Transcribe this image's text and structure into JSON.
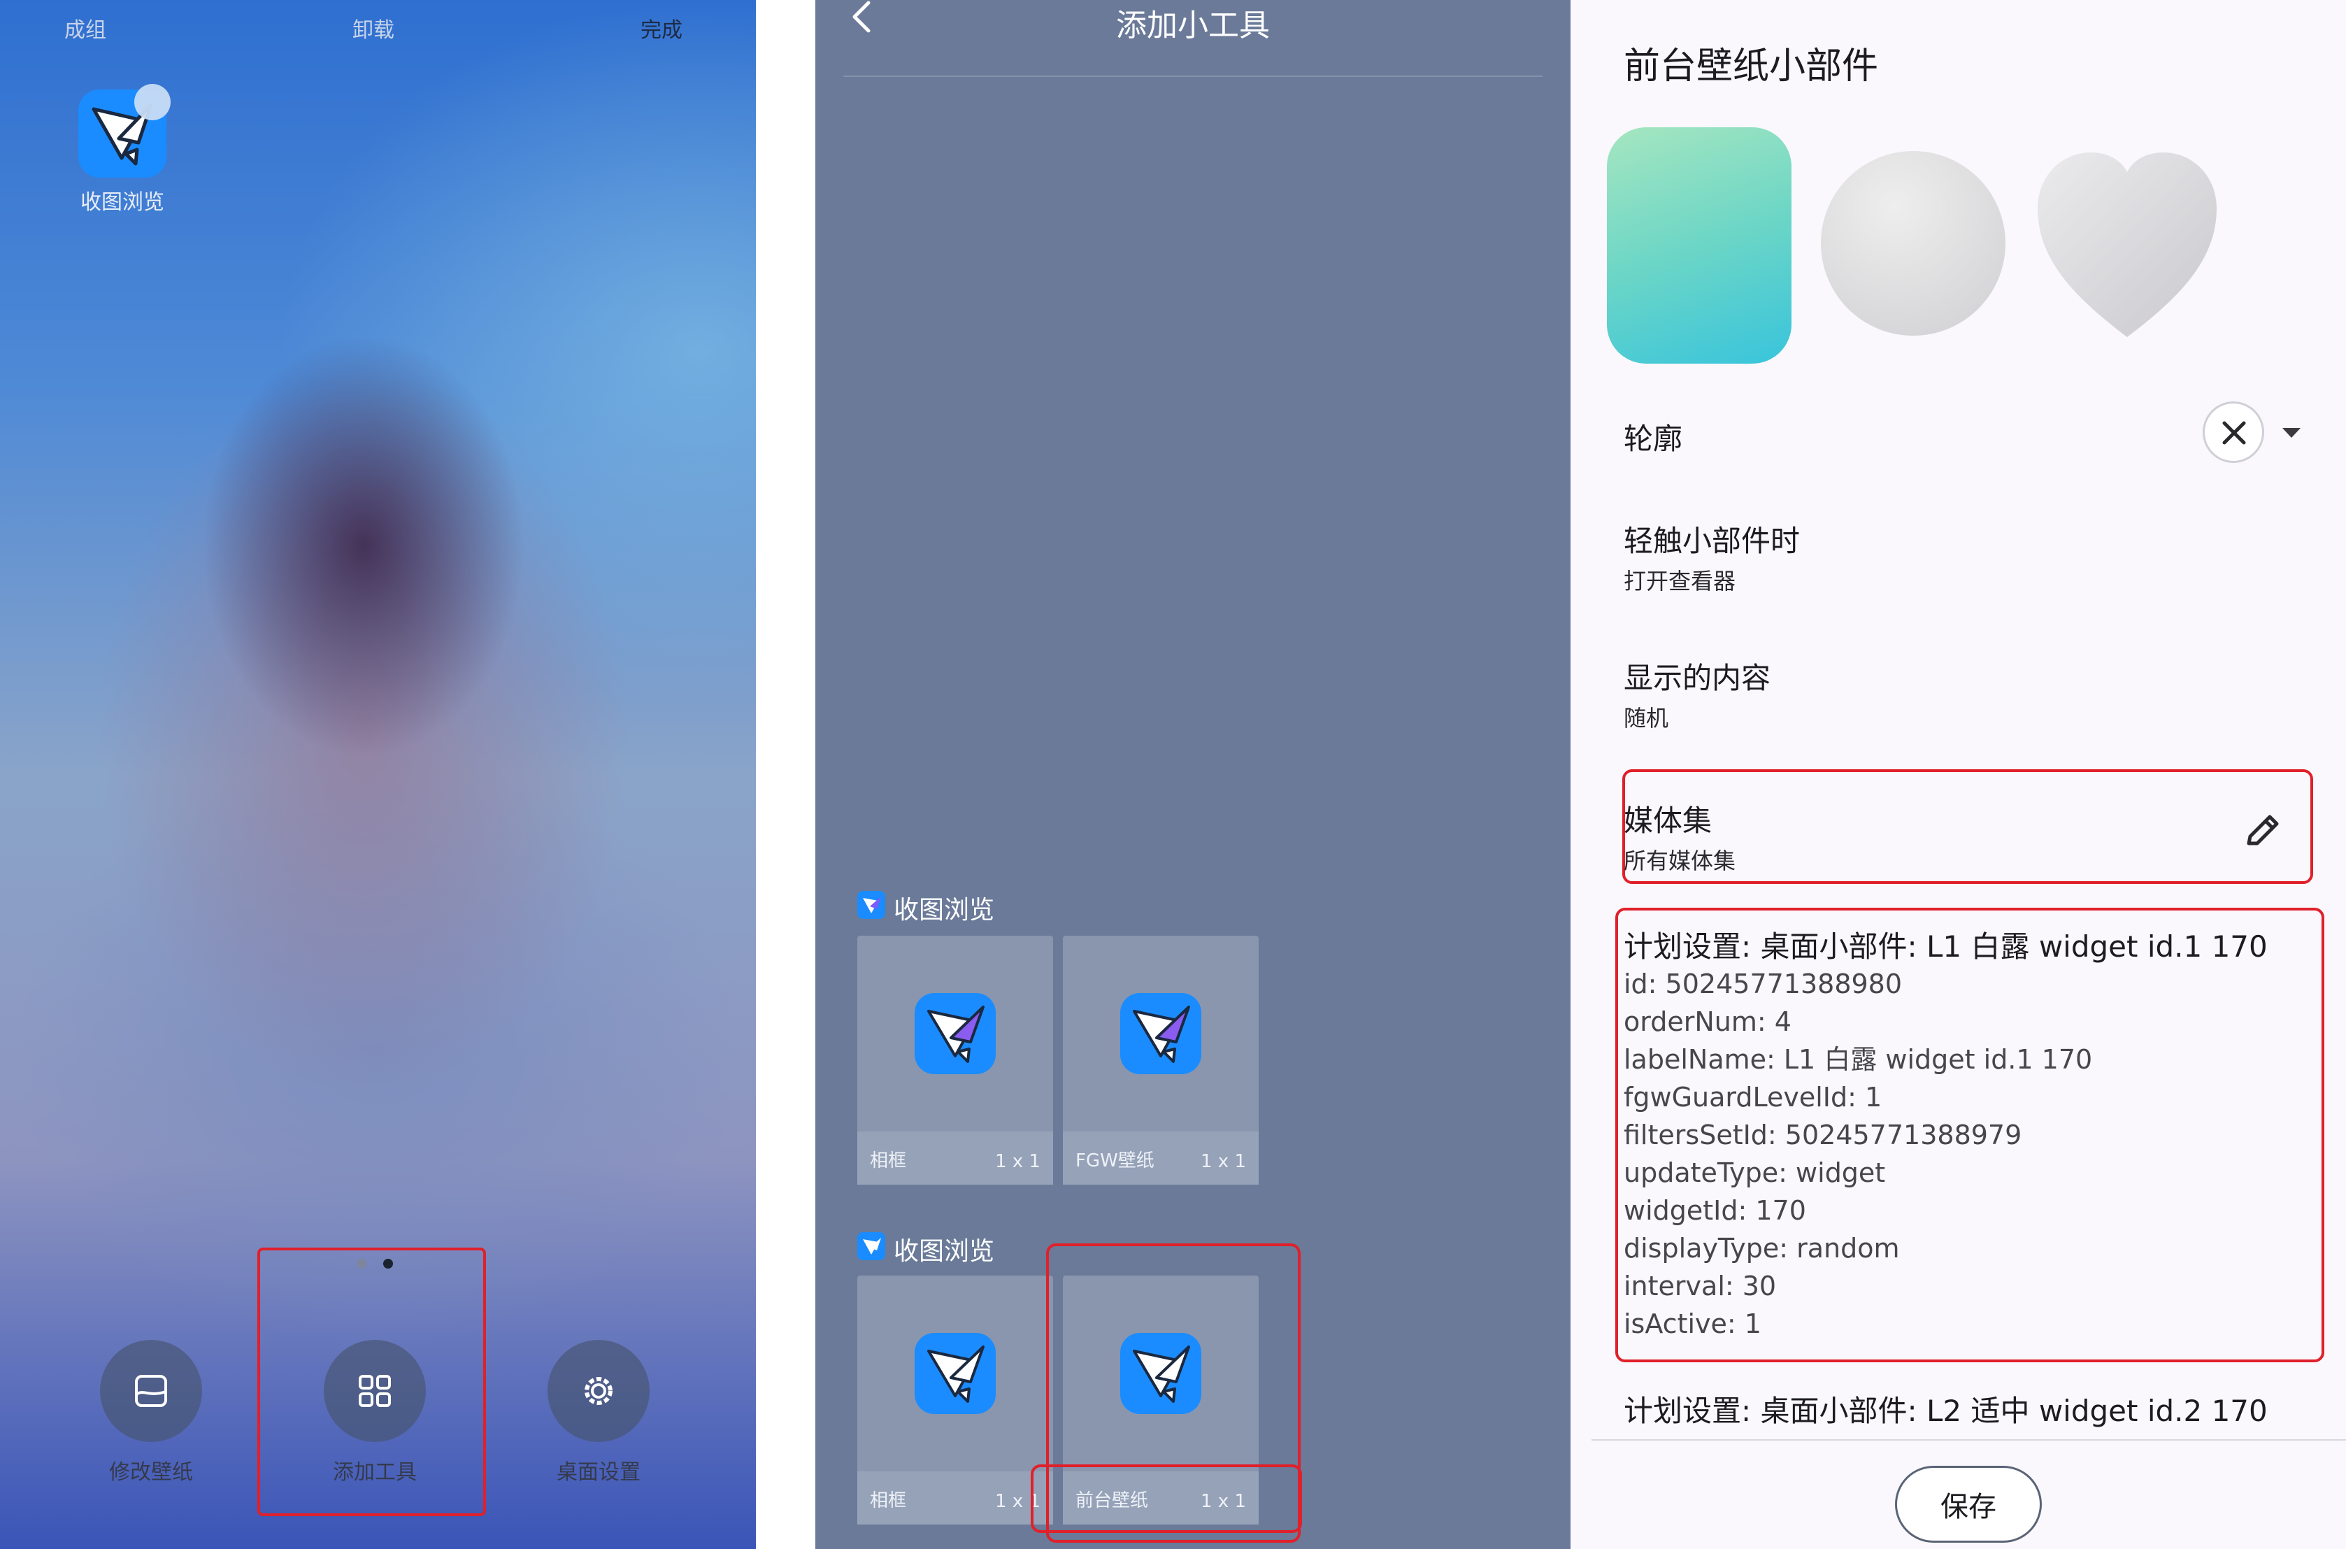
{
  "launcher": {
    "top_actions": [
      "成组",
      "卸载",
      "完成"
    ],
    "app_label": "收图浏览",
    "dock": [
      {
        "label": "修改壁纸",
        "icon": "wallpaper-icon"
      },
      {
        "label": "添加工具",
        "icon": "grid-icon"
      },
      {
        "label": "桌面设置",
        "icon": "gear-icon"
      }
    ]
  },
  "add_widget": {
    "title": "添加小工具",
    "sections": [
      {
        "app": "收图浏览",
        "widgets": [
          {
            "name": "相框",
            "size": "1 x 1"
          },
          {
            "name": "FGW壁纸",
            "size": "1 x 1"
          }
        ]
      },
      {
        "app": "收图浏览",
        "widgets": [
          {
            "name": "相框",
            "size": "1 x 1"
          },
          {
            "name": "前台壁纸",
            "size": "1 x 1"
          }
        ]
      }
    ]
  },
  "settings": {
    "title": "前台壁纸小部件",
    "shapes": [
      "rounded-square",
      "circle",
      "heart"
    ],
    "outline_label": "轮廓",
    "tap_title": "轻触小部件时",
    "tap_value": "打开查看器",
    "content_title": "显示的内容",
    "content_value": "随机",
    "media_title": "媒体集",
    "media_value": "所有媒体集",
    "plan1": {
      "title": "计划设置: 桌面小部件: L1 白露 widget id.1  170",
      "lines": [
        "id: 50245771388980",
        "orderNum: 4",
        "labelName: L1 白露 widget id.1  170",
        "fgwGuardLevelId: 1",
        "filtersSetId: 50245771388979",
        "updateType: widget",
        "widgetId: 170",
        "displayType: random",
        "interval: 30",
        "isActive: 1"
      ]
    },
    "plan2_title": "计划设置: 桌面小部件: L2 适中 widget id.2  170",
    "save_label": "保存"
  },
  "colors": {
    "accent_red": "#e0202a",
    "app_icon_blue": "#1a8cff",
    "panel2_bg": "#6a7a98",
    "panel3_bg": "#faf8fd"
  }
}
